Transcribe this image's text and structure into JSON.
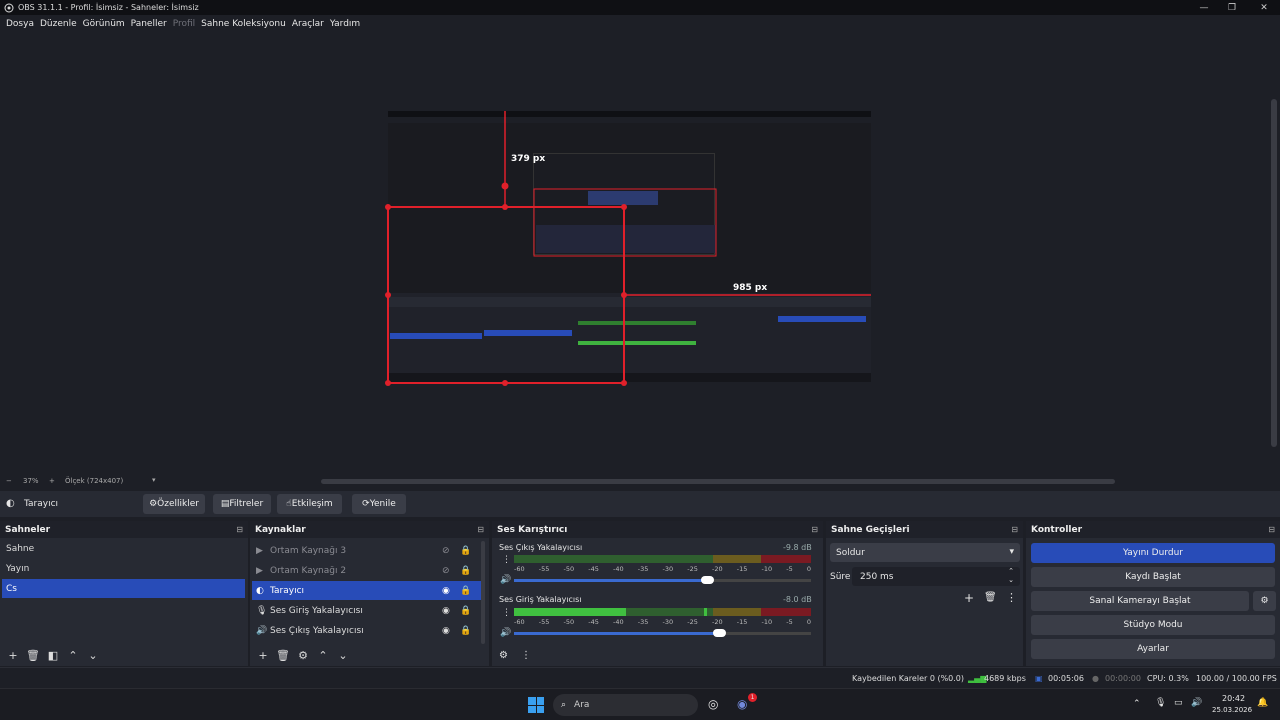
{
  "window": {
    "title": "OBS 31.1.1 - Profil: İsimsiz - Sahneler: İsimsiz"
  },
  "menu": [
    "Dosya",
    "Düzenle",
    "Görünüm",
    "Paneller",
    "Profil",
    "Sahne Koleksiyonu",
    "Araçlar",
    "Yardım"
  ],
  "preview": {
    "label_top": "379 px",
    "label_right": "985 px",
    "zoom_minus": "−",
    "zoom_value": "37%",
    "zoom_plus": "+",
    "scale_label": "Ölçek (724x407)"
  },
  "source_toolbar": {
    "source_name": "Tarayıcı",
    "properties": "Özellikler",
    "filters": "Filtreler",
    "interact": "Etkileşim",
    "refresh": "Yenile"
  },
  "scenes": {
    "title": "Sahneler",
    "items": [
      "Sahne",
      "Yayın",
      "Cs"
    ],
    "selected": "Cs"
  },
  "sources": {
    "title": "Kaynaklar",
    "items": [
      {
        "label": "Ortam Kaynağı 3",
        "icon": "play-icon",
        "visible": false
      },
      {
        "label": "Ortam Kaynağı 2",
        "icon": "play-icon",
        "visible": false
      },
      {
        "label": "Tarayıcı",
        "icon": "globe-icon",
        "visible": true
      },
      {
        "label": "Ses Giriş Yakalayıcısı",
        "icon": "microphone-icon",
        "visible": true
      },
      {
        "label": "Ses Çıkış Yakalayıcısı",
        "icon": "speaker-icon",
        "visible": true
      }
    ]
  },
  "mixer": {
    "title": "Ses Karıştırıcı",
    "channels": [
      {
        "name": "Ses Çıkış Yakalayıcısı",
        "db": "-9.8 dB",
        "volume": 0.65
      },
      {
        "name": "Ses Giriş Yakalayıcısı",
        "db": "-8.0 dB",
        "volume": 0.69
      }
    ],
    "ticks": [
      "-60",
      "-55",
      "-50",
      "-45",
      "-40",
      "-35",
      "-30",
      "-25",
      "-20",
      "-15",
      "-10",
      "-5",
      "0"
    ]
  },
  "transitions": {
    "title": "Sahne Geçişleri",
    "selected": "Soldur",
    "duration_label": "Süre",
    "duration_value": "250 ms"
  },
  "controls": {
    "title": "Kontroller",
    "stop_stream": "Yayını Durdur",
    "start_recording": "Kaydı Başlat",
    "start_virtualcam": "Sanal Kamerayı Başlat",
    "studio_mode": "Stüdyo Modu",
    "settings": "Ayarlar"
  },
  "status": {
    "dropped": "Kaybedilen Kareler 0 (%0.0)",
    "bitrate": "4689 kbps",
    "stream_time": "00:05:06",
    "rec_time": "00:00:00",
    "cpu": "CPU: 0.3%",
    "fps": "100.00 / 100.00 FPS"
  },
  "taskbar": {
    "search": "Ara",
    "time": "20:42",
    "date": "25.03.2026",
    "badge": "1"
  },
  "colors": {
    "accent": "#284cb8",
    "guide": "#e0202a"
  }
}
